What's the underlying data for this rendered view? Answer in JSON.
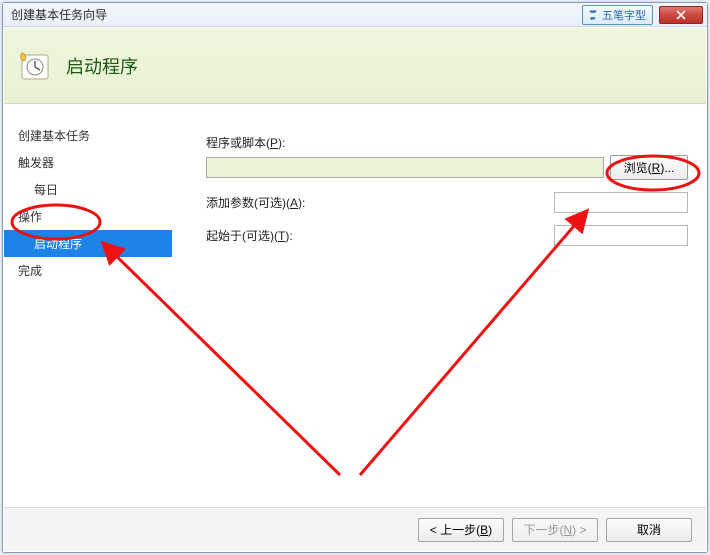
{
  "window": {
    "title": "创建基本任务向导",
    "ime_badge": "五笔字型"
  },
  "header": {
    "heading": "启动程序"
  },
  "sidebar": {
    "items": [
      {
        "label": "创建基本任务"
      },
      {
        "label": "触发器"
      },
      {
        "label": "每日",
        "sub": true
      },
      {
        "label": "操作"
      },
      {
        "label": "启动程序",
        "sub": true,
        "selected": true
      },
      {
        "label": "完成"
      }
    ]
  },
  "form": {
    "program_label_pre": "程序或脚本(",
    "program_label_u": "P",
    "program_label_post": "):",
    "program_value": "",
    "browse_pre": "浏览(",
    "browse_u": "R",
    "browse_post": ")...",
    "args_label_pre": "添加参数(可选)(",
    "args_label_u": "A",
    "args_label_post": "):",
    "args_value": "",
    "startin_label_pre": "起始于(可选)(",
    "startin_label_u": "T",
    "startin_label_post": "):",
    "startin_value": ""
  },
  "footer": {
    "back_pre": "< 上一步(",
    "back_u": "B",
    "back_post": ")",
    "next_pre": "下一步(",
    "next_u": "N",
    "next_post": ") >",
    "cancel": "取消"
  }
}
